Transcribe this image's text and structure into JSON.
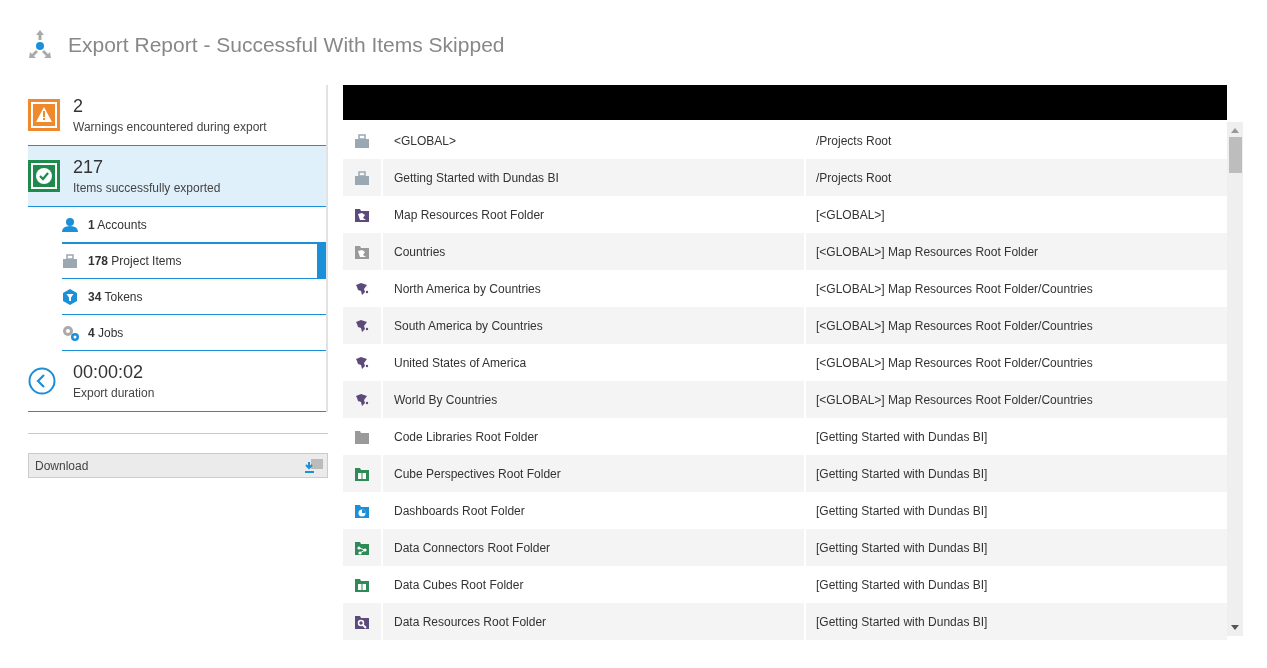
{
  "title": "Export Report - Successful With Items Skipped",
  "summary": [
    {
      "kind": "warning",
      "count": "2",
      "label": "Warnings encountered during export",
      "selected": false
    },
    {
      "kind": "success",
      "count": "217",
      "label": "Items successfully exported",
      "selected": true
    }
  ],
  "categories": [
    {
      "kind": "accounts",
      "count": "1",
      "label": "Accounts",
      "selected": false
    },
    {
      "kind": "project",
      "count": "178",
      "label": "Project Items",
      "selected": true
    },
    {
      "kind": "tokens",
      "count": "34",
      "label": "Tokens",
      "selected": false
    },
    {
      "kind": "jobs",
      "count": "4",
      "label": "Jobs",
      "selected": false
    }
  ],
  "duration": {
    "value": "00:00:02",
    "label": "Export duration"
  },
  "download_button": "Download",
  "rows": [
    {
      "kind": "project",
      "name": "<GLOBAL>",
      "path": "/Projects Root"
    },
    {
      "kind": "project",
      "name": "Getting Started with Dundas BI",
      "path": "/Projects Root"
    },
    {
      "kind": "map-folder",
      "name": "Map Resources Root Folder",
      "path": "[<GLOBAL>]"
    },
    {
      "kind": "map-folder-gray",
      "name": "Countries",
      "path": "[<GLOBAL>] Map Resources Root Folder"
    },
    {
      "kind": "map",
      "name": "North America by Countries",
      "path": "[<GLOBAL>] Map Resources Root Folder/Countries"
    },
    {
      "kind": "map",
      "name": "South America by Countries",
      "path": "[<GLOBAL>] Map Resources Root Folder/Countries"
    },
    {
      "kind": "map",
      "name": "United States of America",
      "path": "[<GLOBAL>] Map Resources Root Folder/Countries"
    },
    {
      "kind": "map",
      "name": "World By Countries",
      "path": "[<GLOBAL>] Map Resources Root Folder/Countries"
    },
    {
      "kind": "folder",
      "name": "Code Libraries Root Folder",
      "path": "[Getting Started with Dundas BI]"
    },
    {
      "kind": "cube-folder",
      "name": "Cube Perspectives Root Folder",
      "path": "[Getting Started with Dundas BI]"
    },
    {
      "kind": "dashboard-folder",
      "name": "Dashboards Root Folder",
      "path": "[Getting Started with Dundas BI]"
    },
    {
      "kind": "connector-folder",
      "name": "Data Connectors Root Folder",
      "path": "[Getting Started with Dundas BI]"
    },
    {
      "kind": "cube-folder",
      "name": "Data Cubes Root Folder",
      "path": "[Getting Started with Dundas BI]"
    },
    {
      "kind": "resource-folder",
      "name": "Data Resources Root Folder",
      "path": "[Getting Started with Dundas BI]"
    }
  ]
}
